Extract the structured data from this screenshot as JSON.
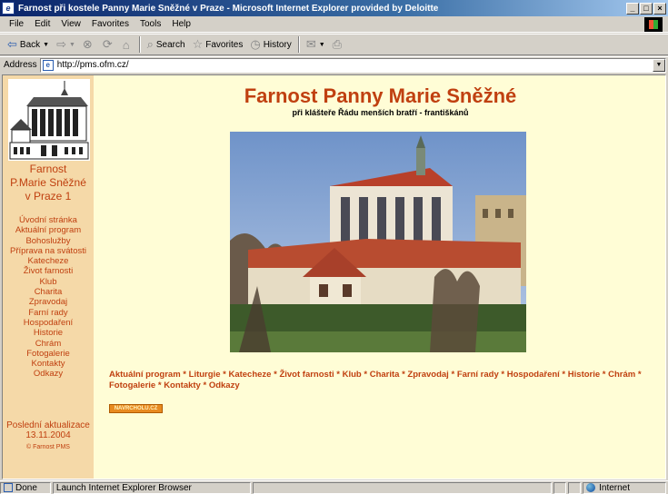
{
  "window": {
    "title": "Farnost při kostele Panny Marie Sněžné v Praze - Microsoft Internet Explorer provided by Deloitte",
    "min": "_",
    "max": "□",
    "close": "×"
  },
  "menu": [
    "File",
    "Edit",
    "View",
    "Favorites",
    "Tools",
    "Help"
  ],
  "toolbar": {
    "back": "Back",
    "search": "Search",
    "favorites": "Favorites",
    "history": "History"
  },
  "address": {
    "label": "Address",
    "url": "http://pms.ofm.cz/"
  },
  "page": {
    "title": "Farnost Panny Marie Sněžné",
    "subtitle": "při klášteře Řádu menších bratří - františkánů",
    "sidebar_name": [
      "Farnost",
      "P.Marie Sněžné",
      "v Praze 1"
    ],
    "nav": [
      "Úvodní stránka",
      "Aktuální program",
      "Bohoslužby",
      "Příprava na svátosti",
      "Katecheze",
      "Život farnosti",
      "Klub",
      "Charita",
      "Zpravodaj",
      "Farní rady",
      "Hospodaření",
      "Historie",
      "Chrám",
      "Fotogalerie",
      "Kontakty",
      "Odkazy"
    ],
    "updated_label": "Poslední aktualizace",
    "updated_date": "13.11.2004",
    "copyright": "© Farnost PMS",
    "bottom_nav": [
      "Aktuální program",
      "Liturgie",
      "Katecheze",
      "Život farnosti",
      "Klub",
      "Charita",
      "Zpravodaj",
      "Farní rady",
      "Hospodaření",
      "Historie",
      "Chrám",
      "Fotogalerie",
      "Kontakty",
      "Odkazy"
    ],
    "badge": "NAVRCHOLU.CZ"
  },
  "status": {
    "state": "Done",
    "message": "Launch Internet Explorer Browser",
    "zone": "Internet"
  },
  "colors": {
    "accent": "#c04010",
    "page_bg": "#fffdd6",
    "sidebar_bg": "#f5d9a8"
  }
}
